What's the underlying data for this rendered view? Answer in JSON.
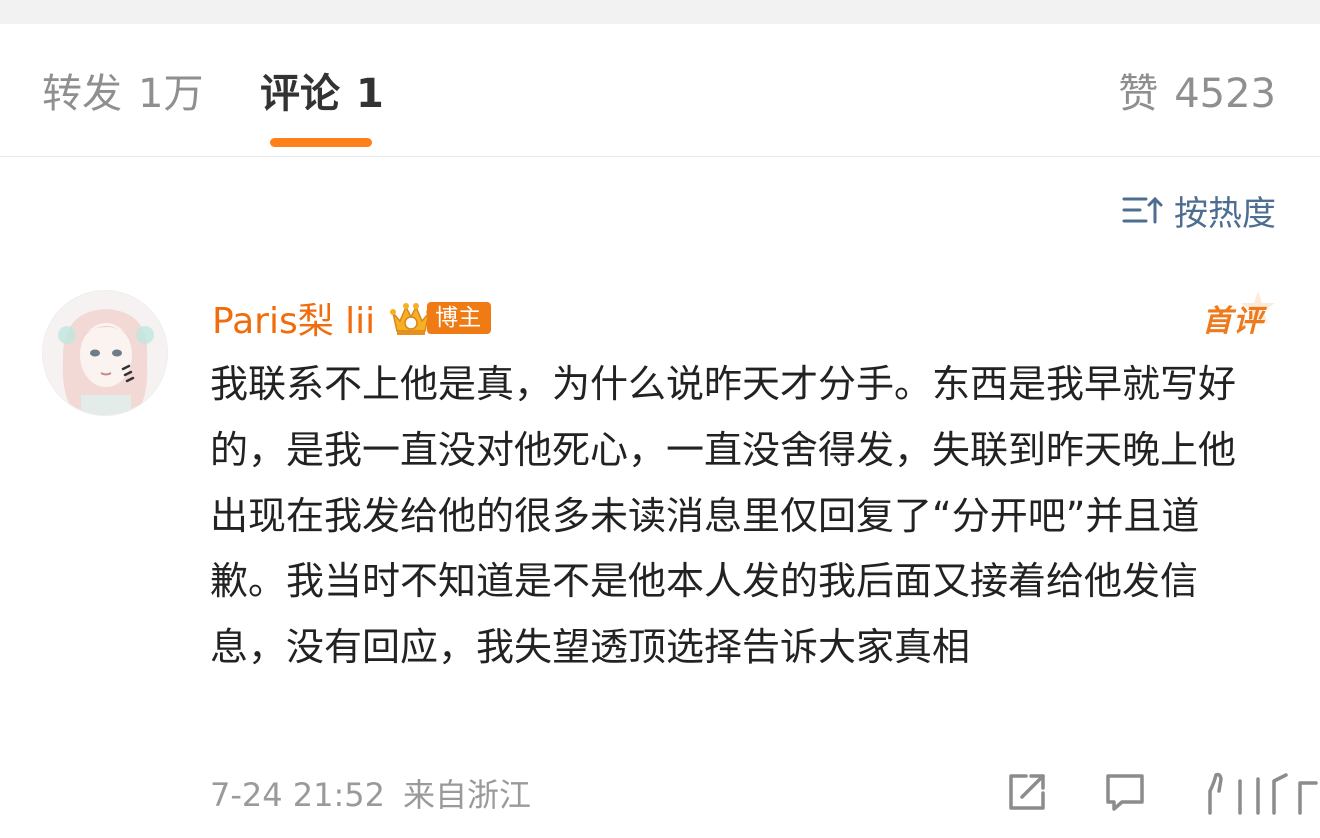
{
  "tabs": {
    "repost": {
      "label": "转发",
      "count": "1万"
    },
    "comment": {
      "label": "评论",
      "count": "1"
    },
    "like": {
      "label": "赞",
      "count": "4523"
    }
  },
  "sort": {
    "label": "按热度",
    "icon": "sort-icon"
  },
  "comment": {
    "username": "Paris梨 lii",
    "badge": "博主",
    "first_tag": "首评",
    "text": "我联系不上他是真，为什么说昨天才分手。东西是我早就写好的，是我一直没对他死心，一直没舍得发，失联到昨天晚上他出现在我发给他的很多未读消息里仅回复了“分开吧”并且道歉。我当时不知道是不是他本人发的我后面又接着给他发信息，没有回应，我失望透顶选择告诉大家真相",
    "time": "7-24 21:52",
    "source": "来自浙江"
  },
  "colors": {
    "accent": "#ff7f1a",
    "username": "#f06c0d",
    "sort": "#4d6e90",
    "muted": "#9a9a9a"
  }
}
